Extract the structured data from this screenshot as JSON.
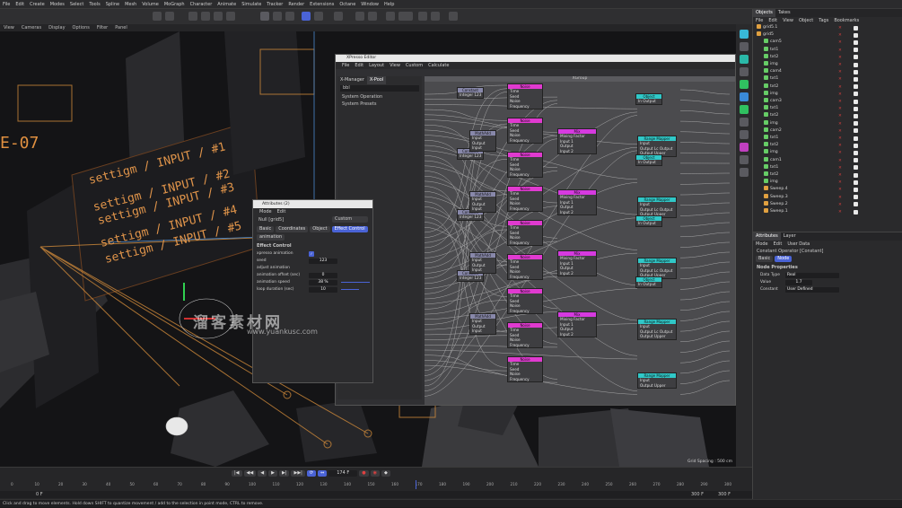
{
  "menubar": {
    "items": [
      "File",
      "Edit",
      "Create",
      "Modes",
      "Select",
      "Tools",
      "Spline",
      "Mesh",
      "Volume",
      "MoGraph",
      "Character",
      "Animate",
      "Simulate",
      "Tracker",
      "Render",
      "Extensions",
      "Octane",
      "Window",
      "Help"
    ]
  },
  "viewport_menu": {
    "items": [
      "View",
      "Cameras",
      "Display",
      "Options",
      "Filter",
      "Panel"
    ]
  },
  "viewport": {
    "labels": [
      "settigm / INPUT / #1",
      "settigm / INPUT / #2",
      "settigm / INPUT / #3",
      "settigm / INPUT / #4",
      "settigm / INPUT / #5"
    ],
    "corner_label": "E-07",
    "grid_spacing": "Grid Spacing : 500 cm"
  },
  "timeline": {
    "current_frame": "174 F",
    "start_frame": "0 F",
    "end_frame": "300 F",
    "end_frame2": "300 F",
    "ticks": [
      "0",
      "10",
      "20",
      "30",
      "40",
      "50",
      "60",
      "70",
      "80",
      "90",
      "100",
      "110",
      "120",
      "130",
      "140",
      "150",
      "160",
      "170",
      "180",
      "190",
      "200",
      "210",
      "220",
      "230",
      "240",
      "250",
      "260",
      "270",
      "280",
      "290",
      "300"
    ]
  },
  "status": {
    "text": "Click and drag to move elements. Hold down SHIFT to quantize movement / add to the selection in point mode, CTRL to remove."
  },
  "objects_panel": {
    "tabs": [
      "Objects",
      "Takes"
    ],
    "menu": [
      "File",
      "Edit",
      "View",
      "Object",
      "Tags",
      "Bookmarks"
    ],
    "rows": [
      {
        "name": "grid5.1",
        "color": "#e0a040"
      },
      {
        "name": "grid5",
        "color": "#e0a040"
      },
      {
        "name": "cam5",
        "color": "#66cc66"
      },
      {
        "name": "txt1",
        "color": "#66cc66"
      },
      {
        "name": "txt2",
        "color": "#66cc66"
      },
      {
        "name": "img",
        "color": "#66cc66"
      },
      {
        "name": "cam4",
        "color": "#66cc66"
      },
      {
        "name": "txt1",
        "color": "#66cc66"
      },
      {
        "name": "txt2",
        "color": "#66cc66"
      },
      {
        "name": "img",
        "color": "#66cc66"
      },
      {
        "name": "cam3",
        "color": "#66cc66"
      },
      {
        "name": "txt1",
        "color": "#66cc66"
      },
      {
        "name": "txt2",
        "color": "#66cc66"
      },
      {
        "name": "img",
        "color": "#66cc66"
      },
      {
        "name": "cam2",
        "color": "#66cc66"
      },
      {
        "name": "txt1",
        "color": "#66cc66"
      },
      {
        "name": "txt2",
        "color": "#66cc66"
      },
      {
        "name": "img",
        "color": "#66cc66"
      },
      {
        "name": "cam1",
        "color": "#66cc66"
      },
      {
        "name": "txt1",
        "color": "#66cc66"
      },
      {
        "name": "txt2",
        "color": "#66cc66"
      },
      {
        "name": "img",
        "color": "#66cc66"
      },
      {
        "name": "Sweep.4",
        "color": "#e0a040"
      },
      {
        "name": "Sweep.3",
        "color": "#e0a040"
      },
      {
        "name": "Sweep.2",
        "color": "#e0a040"
      },
      {
        "name": "Sweep.1",
        "color": "#e0a040"
      }
    ]
  },
  "attributes_panel": {
    "tabs": [
      "Attributes",
      "Layer"
    ],
    "menu": [
      "Mode",
      "Edit",
      "User Data"
    ],
    "title": "Constant Operator [Constant]",
    "sub_tabs": [
      "Basic",
      "Node"
    ],
    "section": "Node Properties",
    "fields": [
      {
        "label": "Data Type",
        "value": "Real"
      },
      {
        "label": "Value",
        "value": "1.7"
      },
      {
        "label": "Constant",
        "value": "User Defined"
      }
    ]
  },
  "xpresso": {
    "title": "XPresso Editor",
    "menu": [
      "File",
      "Edit",
      "Layout",
      "View",
      "Custom",
      "Calculate"
    ],
    "pool_tabs": [
      "X-Manager",
      "X-Pool"
    ],
    "search": "bbl",
    "pool_items": [
      "System Operation",
      "System Presets"
    ],
    "group_title": "XGroup",
    "nodes": [
      {
        "title": "Noise",
        "ports": [
          "Time",
          "Seed",
          "Noise",
          "Frequency"
        ]
      },
      {
        "title": "Noise",
        "ports": [
          "Time",
          "Seed",
          "Noise",
          "Frequency"
        ]
      },
      {
        "title": "Noise",
        "ports": [
          "Time",
          "Seed",
          "Noise",
          "Frequency"
        ]
      },
      {
        "title": "Noise",
        "ports": [
          "Time",
          "Seed",
          "Noise",
          "Frequency"
        ]
      },
      {
        "title": "Noise",
        "ports": [
          "Time",
          "Seed",
          "Noise",
          "Frequency"
        ]
      },
      {
        "title": "Noise",
        "ports": [
          "Time",
          "Seed",
          "Noise",
          "Frequency"
        ]
      },
      {
        "title": "Noise",
        "ports": [
          "Time",
          "Seed",
          "Noise",
          "Frequency"
        ]
      },
      {
        "title": "Noise",
        "ports": [
          "Time",
          "Seed",
          "Noise",
          "Frequency"
        ]
      },
      {
        "title": "Noise",
        "ports": [
          "Time",
          "Seed",
          "Noise",
          "Frequency"
        ]
      },
      {
        "title": "Mix",
        "ports": [
          "Mixing Factor",
          "Input 1",
          "Output",
          "Input 2"
        ]
      },
      {
        "title": "Mix",
        "ports": [
          "Mixing Factor",
          "Input 1",
          "Output",
          "Input 2"
        ]
      },
      {
        "title": "Mix",
        "ports": [
          "Mixing Factor",
          "Input 1",
          "Output",
          "Input 2"
        ]
      },
      {
        "title": "Mix",
        "ports": [
          "Mixing Factor",
          "Input 1",
          "Output",
          "Input 2"
        ]
      },
      {
        "title": "Constant",
        "ports": [
          "Integer 123"
        ]
      },
      {
        "title": "Constant",
        "ports": [
          "Integer 123"
        ]
      },
      {
        "title": "Constant",
        "ports": [
          "Integer 123"
        ]
      },
      {
        "title": "Constant",
        "ports": [
          "Integer 123"
        ]
      },
      {
        "title": "MathAdd",
        "ports": [
          "Input",
          "Output",
          "Input"
        ]
      },
      {
        "title": "MathAdd",
        "ports": [
          "Input",
          "Output",
          "Input"
        ]
      },
      {
        "title": "MathAdd",
        "ports": [
          "Input",
          "Output",
          "Input"
        ]
      },
      {
        "title": "MathAdd",
        "ports": [
          "Input",
          "Output",
          "Input"
        ]
      },
      {
        "title": "Range Mapper",
        "ports": [
          "Input",
          "Output Lc Output",
          "Output Upper"
        ]
      },
      {
        "title": "Range Mapper",
        "ports": [
          "Input",
          "Output Lc Output",
          "Output Upper"
        ]
      },
      {
        "title": "Range Mapper",
        "ports": [
          "Input",
          "Output Lc Output",
          "Output Upper"
        ]
      },
      {
        "title": "Range Mapper",
        "ports": [
          "Input",
          "Output Lc Output",
          "Output Upper"
        ]
      },
      {
        "title": "Object",
        "ports": [
          "In Output"
        ]
      },
      {
        "title": "Object",
        "ports": [
          "In Output"
        ]
      },
      {
        "title": "Object",
        "ports": [
          "In Output"
        ]
      },
      {
        "title": "Object",
        "ports": [
          "In Output"
        ]
      },
      {
        "title": "Range Mapper",
        "ports": [
          "Input",
          "Output Upper"
        ]
      }
    ]
  },
  "attr_window": {
    "title": "Attributes (2)",
    "menu": [
      "Mode",
      "Edit"
    ],
    "object": "Null [grid5]",
    "dropdown": "Custom",
    "tabs": [
      "Basic",
      "Coordinates",
      "Object",
      "Effect Control"
    ],
    "tab2": "animation",
    "section": "Effect Control",
    "fields": [
      {
        "label": "xpresso animation",
        "value": "✓"
      },
      {
        "label": "seed",
        "value": "123"
      },
      {
        "label": "adjust animation",
        "value": ""
      },
      {
        "label": "animation offset (sec)",
        "value": "0"
      },
      {
        "label": "animation speed",
        "value": "38 %"
      },
      {
        "label": "loop duration (sec)",
        "value": "10"
      }
    ]
  },
  "watermark": {
    "text": "溜客素材网",
    "url": "www.yuankusc.com"
  },
  "colors": {
    "accent": "#4a63d6",
    "noise": "#e03ad0",
    "mix": "#d63ae0",
    "range": "#30c8c8",
    "orange": "#e08a3a"
  }
}
